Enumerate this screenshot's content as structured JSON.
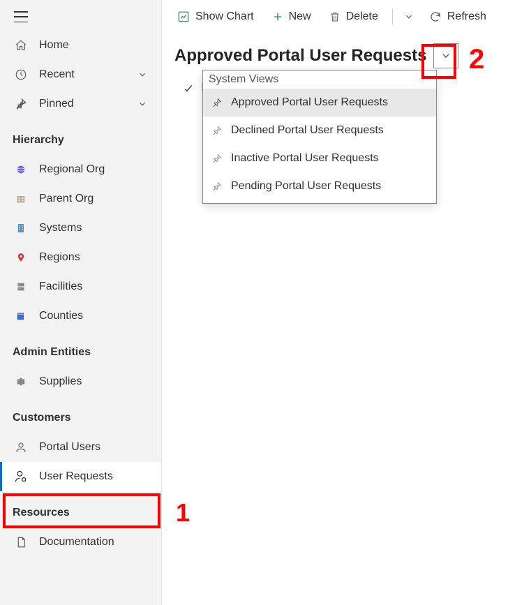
{
  "sidebar": {
    "nav": {
      "home": "Home",
      "recent": "Recent",
      "pinned": "Pinned"
    },
    "sections": {
      "hierarchy": {
        "title": "Hierarchy",
        "items": [
          "Regional Org",
          "Parent Org",
          "Systems",
          "Regions",
          "Facilities",
          "Counties"
        ]
      },
      "admin": {
        "title": "Admin Entities",
        "items": [
          "Supplies"
        ]
      },
      "customers": {
        "title": "Customers",
        "items": [
          "Portal Users",
          "User Requests"
        ]
      },
      "resources": {
        "title": "Resources",
        "items": [
          "Documentation"
        ]
      }
    }
  },
  "cmdbar": {
    "show_chart": "Show Chart",
    "new": "New",
    "delete": "Delete",
    "refresh": "Refresh"
  },
  "view": {
    "title": "Approved Portal User Requests"
  },
  "dropdown": {
    "header": "System Views",
    "items": [
      "Approved Portal User Requests",
      "Declined Portal User Requests",
      "Inactive Portal User Requests",
      "Pending Portal User Requests"
    ]
  },
  "annotations": {
    "one": "1",
    "two": "2"
  }
}
